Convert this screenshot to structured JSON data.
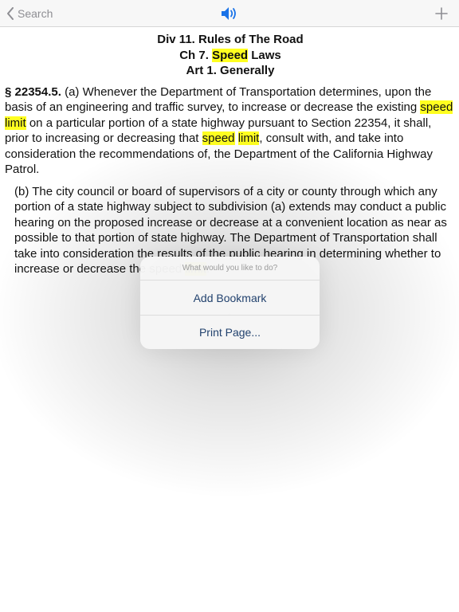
{
  "nav": {
    "back_label": "Search"
  },
  "heading": {
    "line1": "Div 11. Rules of The Road",
    "line2_prefix": "Ch 7. ",
    "line2_highlight": "Speed",
    "line2_suffix": " Laws",
    "line3": "Art 1. Generally"
  },
  "section_a": {
    "number": "§ 22354.5.",
    "t1": " (a) Whenever the Department of Transportation determines, upon the basis of an engineering and traffic survey, to increase or decrease the existing ",
    "h1": "speed",
    "s1": " ",
    "h2": "limit",
    "t2": " on a particular portion of a state highway pursuant to Section 22354, it shall, prior to increasing or decreasing that ",
    "h3": "speed",
    "s2": " ",
    "h4": "limit",
    "t3": ", consult with, and take into consideration the recommendations of, the Department of the California Highway Patrol."
  },
  "section_b": {
    "t1": "(b) The city council or board of supervisors of a city or county through which any portion of a state highway subject to subdivision (a) extends may conduct a public hearing on the proposed increase or decrease at a convenient location as near as possible to that portion of state highway. The Department of Transportation shall take into consideration the results of the public hearing in determining whether to increase or decrease the speed ",
    "h1": "limit",
    "t2": "."
  },
  "popover": {
    "title": "What would you like to do?",
    "items": [
      "Add Bookmark",
      "Print Page..."
    ]
  },
  "colors": {
    "highlight": "#ffff20",
    "popover_text": "#22426e",
    "speaker_blue": "#1a73e8"
  }
}
